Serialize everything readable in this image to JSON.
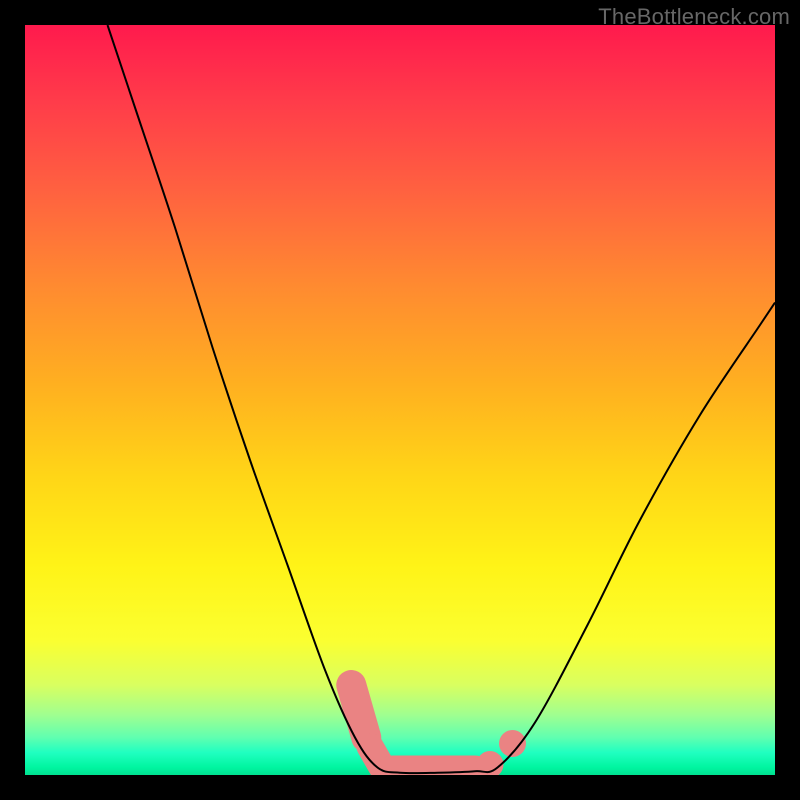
{
  "watermark": "TheBottleneck.com",
  "chart_data": {
    "type": "line",
    "title": "",
    "xlabel": "",
    "ylabel": "",
    "xlim": [
      0,
      100
    ],
    "ylim": [
      0,
      100
    ],
    "grid": false,
    "legend": false,
    "series": [
      {
        "name": "left-curve",
        "stroke": "#000000",
        "x": [
          11,
          15,
          20,
          25,
          30,
          35,
          40,
          44,
          47
        ],
        "y": [
          100,
          88,
          73,
          57,
          42,
          28,
          14,
          5,
          1
        ]
      },
      {
        "name": "valley-floor",
        "stroke": "#000000",
        "x": [
          47,
          50,
          55,
          60,
          63
        ],
        "y": [
          1,
          0.3,
          0.3,
          0.5,
          1
        ]
      },
      {
        "name": "right-curve",
        "stroke": "#000000",
        "x": [
          63,
          68,
          75,
          82,
          90,
          98,
          100
        ],
        "y": [
          1,
          7,
          20,
          34,
          48,
          60,
          63
        ]
      }
    ],
    "markers": [
      {
        "name": "marker-1",
        "shape": "pill",
        "x1": 43.5,
        "y1": 12,
        "x2": 45.5,
        "y2": 5,
        "r": 2.0,
        "color": "#ea8383"
      },
      {
        "name": "marker-2",
        "shape": "pill",
        "x1": 46,
        "y1": 3.8,
        "x2": 47.5,
        "y2": 1.2,
        "r": 1.8,
        "color": "#ea8383"
      },
      {
        "name": "marker-3",
        "shape": "pill",
        "x1": 49,
        "y1": 0.6,
        "x2": 60,
        "y2": 0.6,
        "r": 2.0,
        "color": "#ea8383"
      },
      {
        "name": "marker-4",
        "shape": "round",
        "cx": 62,
        "cy": 1.4,
        "r": 1.8,
        "color": "#ea8383"
      },
      {
        "name": "marker-5",
        "shape": "round",
        "cx": 65,
        "cy": 4.2,
        "r": 1.8,
        "color": "#ea8383"
      }
    ]
  }
}
